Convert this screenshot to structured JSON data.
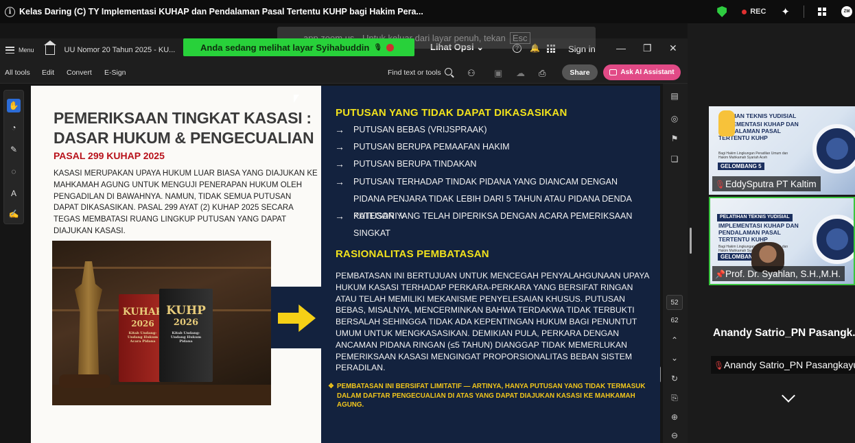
{
  "zoom": {
    "meeting_title": "Kelas Daring (C) TY Implementasi KUHAP dan Pendalaman Pasal Tertentu KUHP bagi Hakim Pera...",
    "rec_label": "REC",
    "avatar_initials": "ZM"
  },
  "share": {
    "banner_text": "Anda sedang melihat layar Syihabuddin",
    "view_options": "Lihat Opsi",
    "fullscreen_hint": "app.zoom.us - Untuk keluar dari layar penuh, tekan",
    "esc_key": "Esc"
  },
  "acrobat": {
    "menu_label": "Menu",
    "tab_label": "UU Nomor 20 Tahun 2025 - KU...",
    "sign_in": "Sign in",
    "tools": [
      "All tools",
      "Edit",
      "Convert",
      "E-Sign"
    ],
    "find_placeholder": "Find text or tools",
    "share_label": "Share",
    "ai_label": "Ask AI Assistant",
    "page_current": "52",
    "page_total": "62"
  },
  "slide": {
    "title": "PEMERIKSAAN TINGKAT KASASI : DASAR HUKUM & PENGECUALIAN",
    "subtitle": "PASAL 299 KUHAP 2025",
    "body": "KASASI MERUPAKAN UPAYA HUKUM LUAR BIASA YANG DIAJUKAN KE MAHKAMAH AGUNG UNTUK MENGUJI PENERAPAN HUKUM OLEH PENGADILAN DI BAWAHNYA. NAMUN, TIDAK SEMUA PUTUSAN DAPAT DIKASASIKAN. PASAL 299 AYAT (2) KUHAP 2025 SECARA TEGAS MEMBATASI RUANG LINGKUP PUTUSAN YANG DAPAT DIAJUKAN KASASI.",
    "book1_title": "KUHAP",
    "book1_year": "2026",
    "book1_sub": "Kitab Undang-Undang Hukum Acara Pidana",
    "book2_title": "KUHP",
    "book2_year": "2026",
    "book2_sub": "Kitab Undang-Undang Hukum Pidana",
    "right_heading1": "PUTUSAN YANG TIDAK DAPAT DIKASASIKAN",
    "items": [
      "PUTUSAN BEBAS (VRIJSPRAAK)",
      "PUTUSAN BERUPA PEMAAFAN HAKIM",
      "PUTUSAN BERUPA TINDAKAN",
      "PUTUSAN TERHADAP TINDAK PIDANA YANG DIANCAM DENGAN PIDANA PENJARA TIDAK LEBIH DARI 5 TAHUN ATAU PIDANA DENDA KATEGORI V",
      "PUTUSAN YANG TELAH DIPERIKSA DENGAN ACARA PEMERIKSAAN SINGKAT"
    ],
    "right_heading2": "RASIONALITAS PEMBATASAN",
    "paragraph": "PEMBATASAN INI BERTUJUAN UNTUK MENCEGAH PENYALAHGUNAAN UPAYA HUKUM KASASI TERHADAP PERKARA-PERKARA YANG BERSIFAT RINGAN ATAU TELAH MEMILIKI MEKANISME PENYELESAIAN KHUSUS. PUTUSAN BEBAS, MISALNYA, MENCERMINKAN BAHWA TERDAKWA TIDAK TERBUKTI BERSALAH SEHINGGA TIDAK ADA KEPENTINGAN HUKUM BAGI PENUNTUT UMUM UNTUK MENGKASASIKAN. DEMIKIAN PULA, PERKARA DENGAN ANCAMAN PIDANA RINGAN (≤5 TAHUN) DIANGGAP TIDAK MEMERLUKAN PEMERIKSAAN KASASI MENGINGAT PROPORSIONALITAS BEBAN SISTEM PERADILAN.",
    "note": "PEMBATASAN INI BERSIFAT LIMITATIF — ARTINYA, HANYA PUTUSAN YANG TIDAK TERMASUK DALAM DAFTAR PENGECUALIAN DI ATAS YANG DAPAT DIAJUKAN KASASI KE MAHKAMAH AGUNG."
  },
  "participants": {
    "tile_title": "IMPLEMENTASI KUHAP DAN PENDALAMAN PASAL TERTENTU KUHP",
    "tile_title2_head": "PELATIHAN TEKNIS YUDISIAL",
    "tile_title1_head": "...IHAN TEKNIS YUDISIAL",
    "tile_sub": "Bagi Hakim Lingkungan Peradilan Umum dan Hakim Mahkamah Syariah Aceh",
    "tile_badge": "GELOMBANG 5",
    "tile_badge_short": "GELOMBANG",
    "p1": "EddySputra PT Kaltim",
    "p2": "Prof. Dr. Syahlan, S.H.,M.H.",
    "p3_big": "Anandy Satrio_PN Pasangk...",
    "p3": "Anandy Satrio_PN Pasangkayu"
  }
}
